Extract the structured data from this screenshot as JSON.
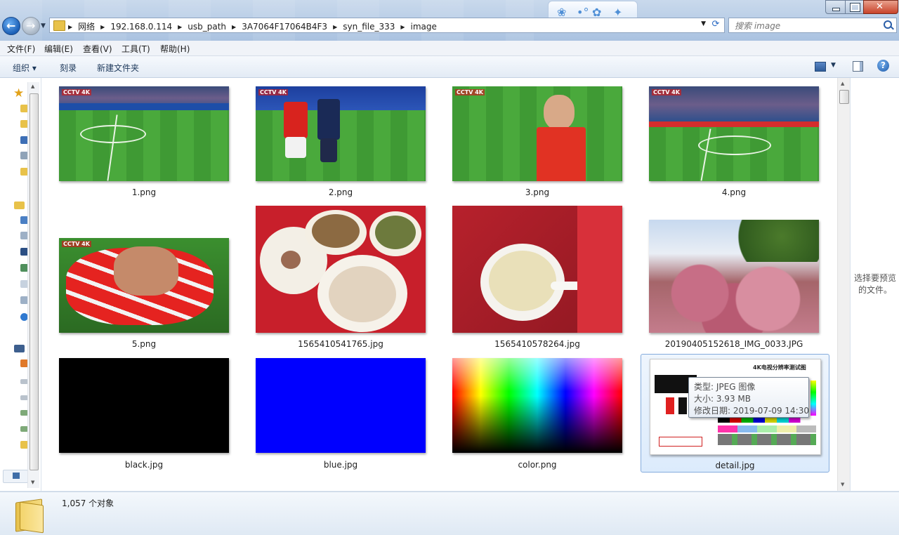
{
  "window": {
    "breadcrumb": [
      "网络",
      "192.168.0.114",
      "usb_path",
      "3A7064F17064B4F3",
      "syn_file_333",
      "image"
    ],
    "search_placeholder": "搜索 image"
  },
  "menu": [
    "文件(F)",
    "编辑(E)",
    "查看(V)",
    "工具(T)",
    "帮助(H)"
  ],
  "toolbar": {
    "organize": "组织 ▾",
    "burn": "刻录",
    "new_folder": "新建文件夹"
  },
  "files": [
    {
      "name": "1.png",
      "kind": "pitch-wide"
    },
    {
      "name": "2.png",
      "kind": "players"
    },
    {
      "name": "3.png",
      "kind": "player-closeup"
    },
    {
      "name": "4.png",
      "kind": "pitch-wide"
    },
    {
      "name": "5.png",
      "kind": "player-down"
    },
    {
      "name": "1565410541765.jpg",
      "kind": "food"
    },
    {
      "name": "1565410578264.jpg",
      "kind": "soup"
    },
    {
      "name": "20190405152618_IMG_0033.JPG",
      "kind": "blossom"
    },
    {
      "name": "black.jpg",
      "kind": "solid",
      "color": "#000000"
    },
    {
      "name": "blue.jpg",
      "kind": "solid",
      "color": "#0000ff"
    },
    {
      "name": "color.png",
      "kind": "spectrum"
    },
    {
      "name": "detail.jpg",
      "kind": "testchart",
      "selected": true
    }
  ],
  "tooltip": {
    "type": "类型: JPEG 图像",
    "size": "大小: 3.93 MB",
    "modified": "修改日期: 2019-07-09 14:30"
  },
  "testchart_title": "4K电视分辨率测试图",
  "preview_text": "选择要预览的文件。",
  "status": {
    "count": "1,057 个对象"
  }
}
